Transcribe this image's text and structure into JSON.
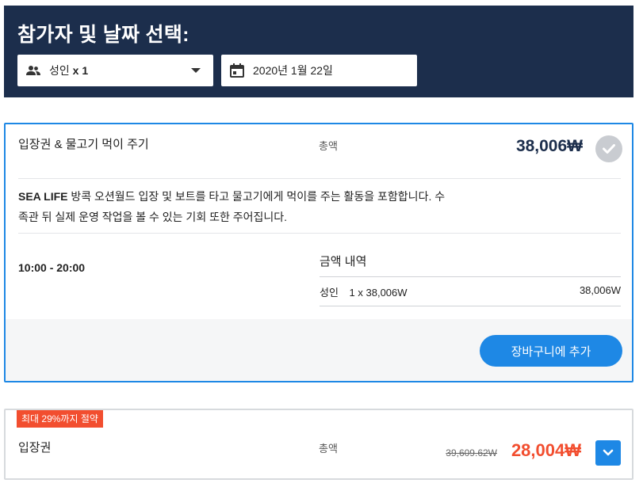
{
  "header": {
    "title": "참가자 및 날짜 선택:",
    "participants": {
      "label": "성인",
      "count": "x 1",
      "icon": "users-icon"
    },
    "date": {
      "value": "2020년 1월 22일",
      "icon": "calendar-icon"
    }
  },
  "products": [
    {
      "title": "입장권 & 물고기 먹이 주기",
      "total_label": "총액",
      "price": "38,006₩",
      "description_brand": "SEA LIFE",
      "description_line1": " 방콕 오션월드 입장 및 보트를 타고 물고기에게 먹이를 주는 활동을 포함합니다. 수",
      "description_line2": "족관 뒤 실제 운영 작업을 볼 수 있는 기회 또한 주어집니다.",
      "time": "10:00 - 20:00",
      "breakdown": {
        "title": "금액 내역",
        "rows": [
          {
            "who": "성인",
            "detail": "1 x 38,006W",
            "amount": "38,006W"
          }
        ]
      },
      "cta": "장바구니에 추가"
    },
    {
      "badge": "최대 29%까지 절약",
      "title": "입장권",
      "total_label": "총액",
      "old_price": "39,609.62W",
      "price": "28,004₩"
    }
  ],
  "colors": {
    "header_bg": "#1c2e4c",
    "accent": "#1e88e5",
    "sale": "#f24e2f"
  }
}
